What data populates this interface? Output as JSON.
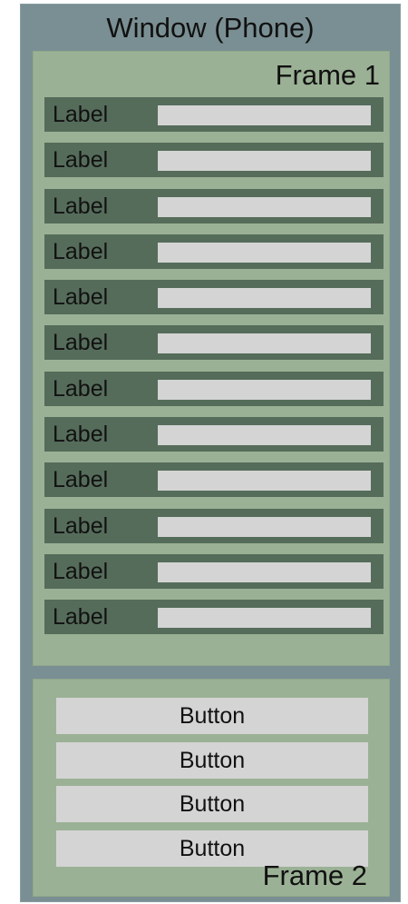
{
  "window": {
    "title": "Window (Phone)"
  },
  "frame1": {
    "title": "Frame 1",
    "rows": [
      {
        "label": "Label"
      },
      {
        "label": "Label"
      },
      {
        "label": "Label"
      },
      {
        "label": "Label"
      },
      {
        "label": "Label"
      },
      {
        "label": "Label"
      },
      {
        "label": "Label"
      },
      {
        "label": "Label"
      },
      {
        "label": "Label"
      },
      {
        "label": "Label"
      },
      {
        "label": "Label"
      },
      {
        "label": "Label"
      }
    ]
  },
  "frame2": {
    "title": "Frame 2",
    "buttons": [
      {
        "label": "Button"
      },
      {
        "label": "Button"
      },
      {
        "label": "Button"
      },
      {
        "label": "Button"
      }
    ]
  },
  "colors": {
    "window_bg": "#7a8f93",
    "frame_bg": "#9bb195",
    "row_bg": "#556c5a",
    "field_bg": "#d4d4d4"
  }
}
